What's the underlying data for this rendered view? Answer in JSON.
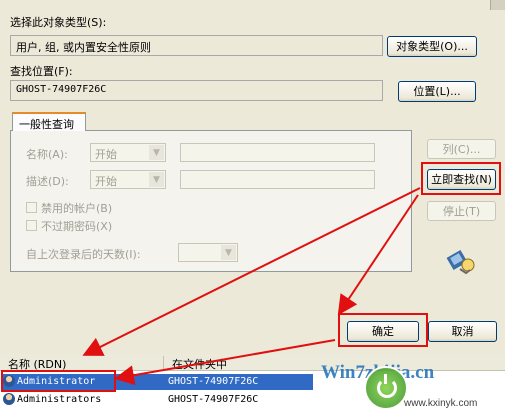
{
  "object_type": {
    "label": "选择此对象类型(S):",
    "value": "用户, 组, 或内置安全性原则",
    "button": "对象类型(O)..."
  },
  "location": {
    "label": "查找位置(F):",
    "value": "GHOST-74907F26C",
    "button": "位置(L)..."
  },
  "query_tab": {
    "label": "一般性查询"
  },
  "query": {
    "name_label": "名称(A):",
    "desc_label": "描述(D):",
    "start_option": "开始",
    "disabled_accounts": "禁用的帐户(B)",
    "non_expiring_pw": "不过期密码(X)",
    "days_since_logon": "自上次登录后的天数(I):"
  },
  "side_buttons": {
    "columns": "列(C)...",
    "find_now": "立即查找(N)",
    "stop": "停止(T)"
  },
  "ok": "确定",
  "cancel": "取消",
  "results": {
    "col_name": "名称 (RDN)",
    "col_folder": "在文件夹中",
    "rows": [
      {
        "name": "Administrator",
        "folder": "GHOST-74907F26C"
      },
      {
        "name": "Administrators",
        "folder": "GHOST-74907F26C"
      }
    ]
  },
  "watermark": {
    "brand": "Win7zhijia.cn",
    "site": "www.kxinyk.com"
  },
  "colors": {
    "annotation_red": "#e01010",
    "selection_blue": "#316ac5",
    "tab_accent": "#e68b2c"
  }
}
